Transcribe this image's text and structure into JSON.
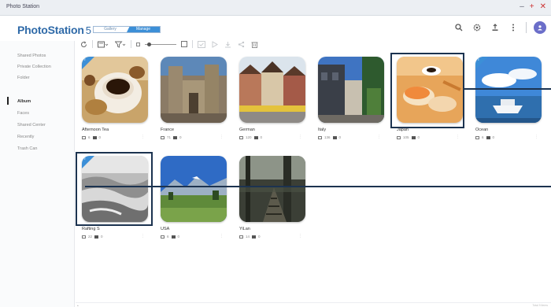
{
  "window": {
    "title": "Photo Station",
    "controls": [
      "–",
      "+",
      "✕"
    ]
  },
  "header": {
    "logo": "PhotoStation",
    "version": "5",
    "modes": [
      "Gallery",
      "Manage"
    ],
    "active_mode": "Manage",
    "icons": [
      "search-icon",
      "settings-icon",
      "upload-icon",
      "more-icon",
      "user-avatar-icon"
    ],
    "accent": "#3c8fd7",
    "logo_color": "#2f6aa8"
  },
  "sidebar": {
    "items": [
      {
        "label": "Shared Photos"
      },
      {
        "label": "Private Collection"
      },
      {
        "label": "Folder"
      },
      {
        "label": "Album",
        "active": true
      },
      {
        "label": "Faces"
      },
      {
        "label": "Shared Center"
      },
      {
        "label": "Recently"
      },
      {
        "label": "Trash Can"
      }
    ]
  },
  "toolbar": {
    "buttons": [
      "refresh-icon",
      "display-mode-icon",
      "filter-icon",
      "zoom-slider",
      "select-all-icon",
      "slideshow-icon",
      "download-icon",
      "share-icon",
      "delete-icon"
    ]
  },
  "albums": [
    {
      "name": "Afternoon Tea",
      "photos": "6",
      "videos": "0",
      "shared": true
    },
    {
      "name": "France",
      "photos": "71",
      "videos": "0",
      "shared": false
    },
    {
      "name": "German",
      "photos": "120",
      "videos": "0",
      "shared": false
    },
    {
      "name": "Italy",
      "photos": "136",
      "videos": "0",
      "shared": false
    },
    {
      "name": "Japan",
      "photos": "105",
      "videos": "0",
      "shared": false
    },
    {
      "name": "Ocean",
      "photos": "6",
      "videos": "0",
      "shared": true
    },
    {
      "name": "Rafting S",
      "photos": "22",
      "videos": "0",
      "shared": true
    },
    {
      "name": "USA",
      "photos": "6",
      "videos": "0",
      "shared": false
    },
    {
      "name": "YiLan",
      "photos": "14",
      "videos": "0",
      "shared": false
    }
  ],
  "status_bar": {
    "left": "▴",
    "right": "Total 9 items"
  },
  "highlight_color": "#1c3350"
}
